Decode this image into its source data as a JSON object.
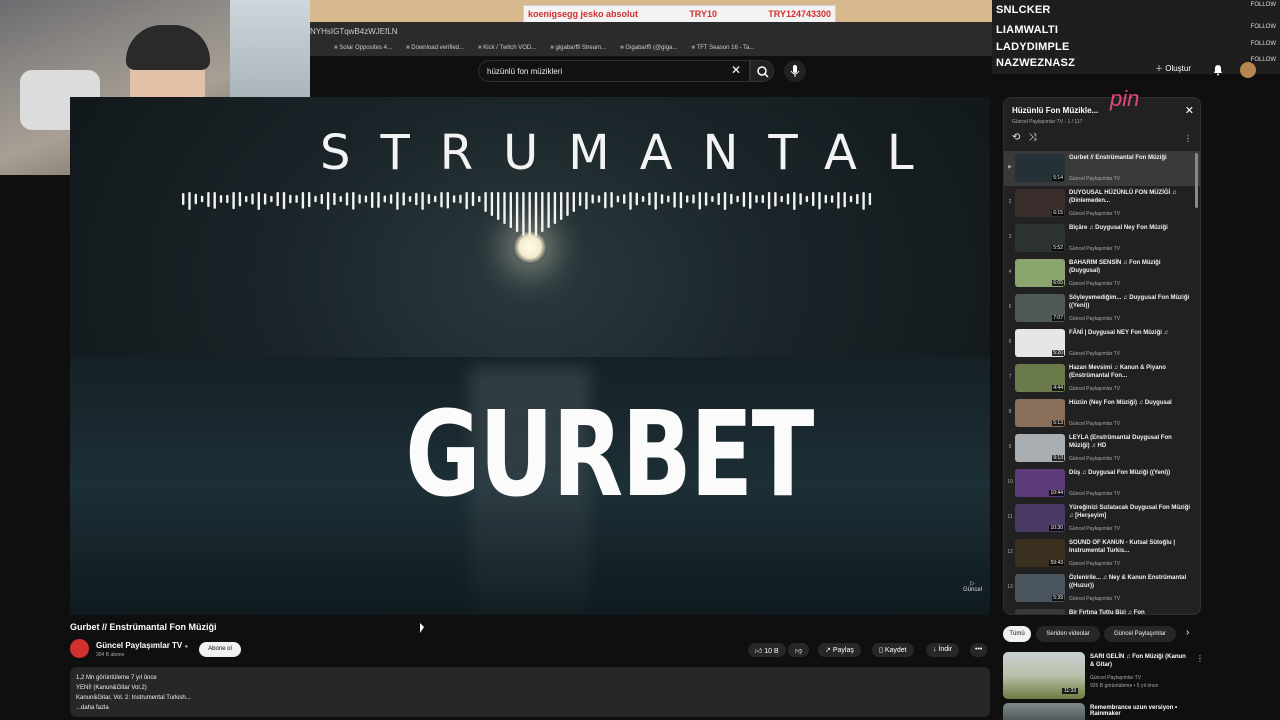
{
  "ticker": {
    "left": "koenigsegg jesko absolut",
    "mid": "TRY10",
    "right": "TRY124743300"
  },
  "browser": {
    "url": "NYHsIGTqwB4zWJEfLN",
    "bookmarks": [
      "Solar Opposites 4...",
      "Download verified...",
      "Kick / Twitch VOD...",
      "gigabarffi Stream...",
      "Gigabarffi (@giga...",
      "TFT Season 16 - Ta..."
    ]
  },
  "events": [
    {
      "name": "SNLCKER",
      "action": "FOLLOW"
    },
    {
      "name": "LIAMWALTI",
      "action": "FOLLOW"
    },
    {
      "name": "LADYDIMPLE",
      "action": "FOLLOW"
    },
    {
      "name": "NAZWEZNASZ",
      "action": "FOLLOW"
    }
  ],
  "header": {
    "search_query": "hüzünlü fon müzikleri",
    "create_label": "Oluştur"
  },
  "player": {
    "top_word": "STRUMANTAL",
    "main_word": "GURBET",
    "brand": "Güncel"
  },
  "video": {
    "title": "Gurbet // Enstrümantal Fon Müziği",
    "channel": "Güncel Paylaşımlar TV",
    "subs": "304 B abone",
    "subscribe": "Abone ol",
    "likes": "10 B",
    "share": "Paylaş",
    "save": "Kaydet",
    "download": "İndir",
    "desc_line1": "1,2 Mn görüntüleme  7 yıl önce",
    "desc_line2": "YENİ! (Kanun&Gitar Vol.2)",
    "desc_line3": "Kanun&Gitar, Vol. 2: Instrumental Turkish...",
    "desc_more": "...daha fazla"
  },
  "playlist": {
    "title": "Hüzünlü Fon Müzikle...",
    "subtitle": "Güncel Paylaşımlar TV - 1 / 117",
    "logo": "pin",
    "items": [
      {
        "num": "▶",
        "name": "Gurbet // Enstrümantal Fon Müziği",
        "dur": "5:14",
        "ch": "Güncel Paylaşımlar TV",
        "color": "#243238"
      },
      {
        "num": "2",
        "name": "DUYGUSAL HÜZÜNLÜ FON MÜZİĞİ ♫ (Dinlemeden...",
        "dur": "6:15",
        "ch": "Güncel Paylaşımlar TV",
        "color": "#3b2d2b"
      },
      {
        "num": "3",
        "name": "Bîçâre ♫ Duygusal Ney Fon Müziği",
        "dur": "5:52",
        "ch": "Güncel Paylaşımlar TV",
        "color": "#2d3330"
      },
      {
        "num": "4",
        "name": "BAHARIM SENSİN ♫ Fon Müziği (Duygusal)",
        "dur": "6:05",
        "ch": "Güncel Paylaşımlar TV",
        "color": "#8aa56d"
      },
      {
        "num": "5",
        "name": "Söyleyemediğim... ♫ Duygusal Fon Müziği ((Yeni))",
        "dur": "7:07",
        "ch": "Güncel Paylaşımlar TV",
        "color": "#4f5a55"
      },
      {
        "num": "6",
        "name": "FÂNİ | Duygusal NEY Fon Müziği ♫",
        "dur": "5:20",
        "ch": "Güncel Paylaşımlar TV",
        "color": "#e6e6e6"
      },
      {
        "num": "7",
        "name": "Hazan Mevsimi ♫ Kanun & Piyano (Enstrümantal Fon...",
        "dur": "4:44",
        "ch": "Güncel Paylaşımlar TV",
        "color": "#6b7a4a"
      },
      {
        "num": "8",
        "name": "Hüzün (Ney Fon Müziği) ♫ Duygusal",
        "dur": "5:13",
        "ch": "Güncel Paylaşımlar TV",
        "color": "#8a6f5a"
      },
      {
        "num": "9",
        "name": "LEYLA (Enstrümantal Duygusal Fon Müziği) ♫ HD",
        "dur": "9:13",
        "ch": "Güncel Paylaşımlar TV",
        "color": "#a9aeb2"
      },
      {
        "num": "10",
        "name": "Düş ♫ Duygusal Fon Müziği ((Yeni))",
        "dur": "10:44",
        "ch": "Güncel Paylaşımlar TV",
        "color": "#5c3d7a"
      },
      {
        "num": "11",
        "name": "Yüreğinizi Sızlatacak Duygusal Fon Müziği ♫ [Herşeyim]",
        "dur": "10:30",
        "ch": "Güncel Paylaşımlar TV",
        "color": "#4a3a66"
      },
      {
        "num": "12",
        "name": "SOUND OF KANUN - Kutsal Sütoğlu | Instrumental Turkis...",
        "dur": "59:43",
        "ch": "Güncel Paylaşımlar TV",
        "color": "#3a3020"
      },
      {
        "num": "13",
        "name": "Özlenirile... ♫ Ney & Kanun Enstrümantal ((Huzur))",
        "dur": "5:39",
        "ch": "Güncel Paylaşımlar TV",
        "color": "#4b5560"
      },
      {
        "num": "14",
        "name": "Bir Fırtına Tuttu Bizi ♫ Fon",
        "dur": "",
        "ch": "",
        "color": "#3a3a3a"
      }
    ]
  },
  "chips": [
    "Tümü",
    "Seriden videolar",
    "Güncel Paylaşımlar"
  ],
  "recommendation": {
    "title": "SARI GELİN ♫ Fon Müziği (Kanun & Gitar)",
    "channel": "Güncel Paylaşımlar TV",
    "meta": "926 B görüntüleme • 5 yıl önce",
    "dur": "11:33",
    "title2": "Remembrance uzun versiyon • Rainmaker"
  }
}
